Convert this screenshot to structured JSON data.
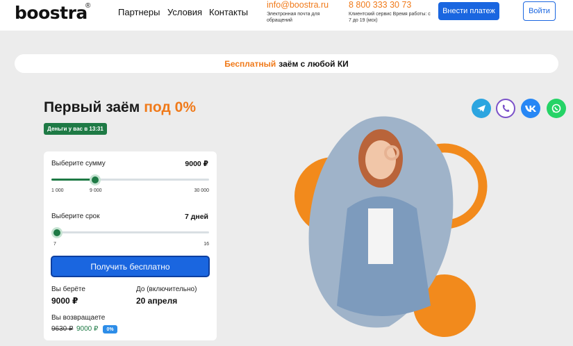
{
  "header": {
    "logo": "boostra",
    "logo_mark": "®",
    "nav": [
      "Партнеры",
      "Условия",
      "Контакты"
    ],
    "email": "info@boostra.ru",
    "email_sub": "Электронная почта для обращений",
    "phone": "8 800 333 30 73",
    "phone_sub": "Клиентский сервис Время работы: с 7 до 19 (мск)",
    "pay_button": "Внести платеж",
    "login_button": "Войти"
  },
  "promo": {
    "highlight": "Бесплатный",
    "text": "заём с любой КИ"
  },
  "hero": {
    "title": "Первый заём",
    "title_highlight": "под 0%",
    "badge": "Деньги у вас в 13:31"
  },
  "calculator": {
    "sum_label": "Выберите сумму",
    "sum_value": "9000 ₽",
    "sum_min": "1 000",
    "sum_current": "9 000",
    "sum_max": "30 000",
    "sum_fraction": 0.276,
    "term_label": "Выберите срок",
    "term_value": "7 дней",
    "term_min": "7",
    "term_max": "16",
    "term_fraction": 0,
    "submit_button": "Получить бесплатно",
    "take_label": "Вы берёте",
    "take_value": "9000 ₽",
    "until_label": "До (включительно)",
    "until_value": "20 апреля",
    "return_label": "Вы возвращаете",
    "return_old": "9630 ₽",
    "return_new": "9000 ₽",
    "return_badge": "0%"
  },
  "social": [
    "telegram-icon",
    "viber-icon",
    "vk-icon",
    "whatsapp-icon"
  ],
  "colors": {
    "accent": "#f07a1a",
    "primary": "#1a66e0",
    "green": "#1e7a45"
  }
}
